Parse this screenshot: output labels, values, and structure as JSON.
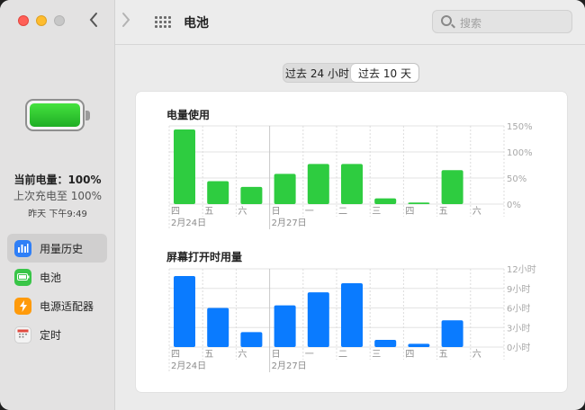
{
  "window": {
    "title": "电池",
    "search_placeholder": "搜索"
  },
  "sidebar": {
    "current_level": "当前电量：100%",
    "last_charged": "上次充电至 100%",
    "last_charged_time": "昨天 下午9:49",
    "items": [
      {
        "label": "用量历史",
        "icon": "usage-history-icon",
        "active": true
      },
      {
        "label": "电池",
        "icon": "battery-icon",
        "active": false
      },
      {
        "label": "电源适配器",
        "icon": "power-adapter-icon",
        "active": false
      },
      {
        "label": "定时",
        "icon": "schedule-icon",
        "active": false
      }
    ]
  },
  "range_tabs": [
    {
      "label": "过去 24 小时",
      "active": false
    },
    {
      "label": "过去 10 天",
      "active": true
    }
  ],
  "colors": {
    "battery_bar": "#2ecc40",
    "screen_bar": "#0a7bff",
    "accent": "#2f7ff7"
  },
  "chart_data": [
    {
      "type": "bar",
      "title": "电量使用",
      "categories": [
        "四",
        "五",
        "六",
        "日",
        "一",
        "二",
        "三",
        "四",
        "五",
        "六"
      ],
      "date_labels": [
        "2月24日",
        "2月27日"
      ],
      "values": [
        143,
        44,
        33,
        58,
        77,
        77,
        11,
        3,
        65,
        0
      ],
      "yticks": [
        "150%",
        "100%",
        "50%",
        "0%"
      ],
      "ylim": [
        0,
        150
      ],
      "ylabel": ""
    },
    {
      "type": "bar",
      "title": "屏幕打开时用量",
      "categories": [
        "四",
        "五",
        "六",
        "日",
        "一",
        "二",
        "三",
        "四",
        "五",
        "六"
      ],
      "date_labels": [
        "2月24日",
        "2月27日"
      ],
      "values": [
        10.9,
        6.0,
        2.3,
        6.4,
        8.4,
        9.8,
        1.1,
        0.5,
        4.1,
        0
      ],
      "yticks": [
        "12小时",
        "9小时",
        "6小时",
        "3小时",
        "0小时"
      ],
      "ylim": [
        0,
        12
      ],
      "ylabel": ""
    }
  ]
}
